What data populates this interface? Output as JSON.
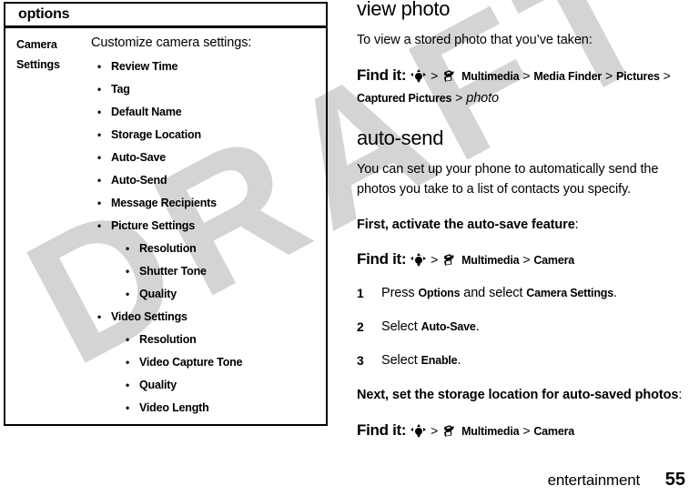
{
  "watermark": {
    "text": "DRAFT"
  },
  "options_table": {
    "header": "options",
    "row": {
      "label_lines": [
        "Camera",
        "Settings"
      ],
      "intro": "Customize camera settings:",
      "items": [
        {
          "level": 1,
          "label": "Review Time"
        },
        {
          "level": 1,
          "label": "Tag"
        },
        {
          "level": 1,
          "label": "Default Name"
        },
        {
          "level": 1,
          "label": "Storage Location"
        },
        {
          "level": 1,
          "label": "Auto-Save"
        },
        {
          "level": 1,
          "label": "Auto-Send"
        },
        {
          "level": 1,
          "label": "Message Recipients"
        },
        {
          "level": 1,
          "label": "Picture Settings"
        },
        {
          "level": 2,
          "label": "Resolution"
        },
        {
          "level": 2,
          "label": "Shutter Tone"
        },
        {
          "level": 2,
          "label": "Quality"
        },
        {
          "level": 1,
          "label": "Video Settings"
        },
        {
          "level": 2,
          "label": "Resolution"
        },
        {
          "level": 2,
          "label": "Video Capture Tone"
        },
        {
          "level": 2,
          "label": "Quality"
        },
        {
          "level": 2,
          "label": "Video Length"
        }
      ]
    }
  },
  "content": {
    "view_photo": {
      "title": "view photo",
      "body": "To view a stored photo that you’ve taken:",
      "find_it": {
        "label": "Find it:",
        "joystick_icon": "joystick-nav-icon",
        "multimedia_icon": "multimedia-icon",
        "sep": ">",
        "path": [
          "Multimedia",
          "Media Finder",
          "Pictures",
          "Captured Pictures"
        ],
        "italic_tail": "photo"
      }
    },
    "auto_send": {
      "title": "auto-send",
      "body": "You can set up your phone to automatically send the photos you take to a list of contacts you specify.",
      "lead_1_bold": "First, activate the auto-save feature",
      "lead_1_tail": ":",
      "find_it_1": {
        "label": "Find it:",
        "joystick_icon": "joystick-nav-icon",
        "multimedia_icon": "multimedia-icon",
        "sep": ">",
        "path": [
          "Multimedia",
          "Camera"
        ]
      },
      "steps": [
        {
          "num": "1",
          "pre": "Press ",
          "b1": "Options",
          "mid": " and select ",
          "b2": "Camera Settings",
          "post": "."
        },
        {
          "num": "2",
          "pre": "Select ",
          "b1": "Auto-Save",
          "mid": "",
          "b2": "",
          "post": "."
        },
        {
          "num": "3",
          "pre": "Select ",
          "b1": "Enable",
          "mid": "",
          "b2": "",
          "post": "."
        }
      ],
      "lead_2_bold": "Next, set the storage location for auto-saved photos",
      "lead_2_tail": ":",
      "find_it_2": {
        "label": "Find it:",
        "joystick_icon": "joystick-nav-icon",
        "multimedia_icon": "multimedia-icon",
        "sep": ">",
        "path": [
          "Multimedia",
          "Camera"
        ]
      }
    }
  },
  "footer": {
    "chapter": "entertainment",
    "page_number": "55"
  }
}
